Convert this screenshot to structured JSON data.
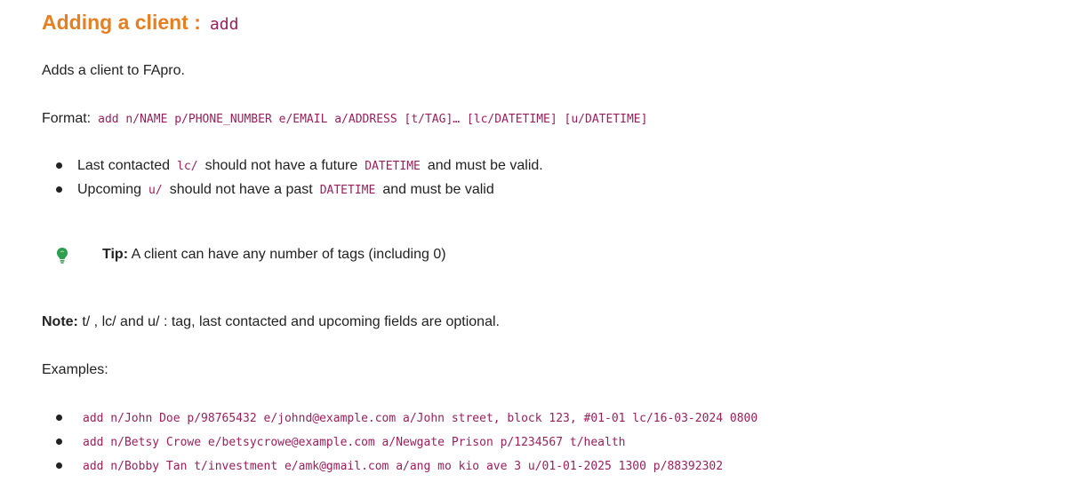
{
  "heading": {
    "title": "Adding a client :",
    "command": "add"
  },
  "description": "Adds a client to FApro.",
  "format": {
    "label": "Format:",
    "syntax": "add n/NAME p/PHONE_NUMBER e/EMAIL a/ADDRESS [t/TAG]… [lc/DATETIME] [u/DATETIME]"
  },
  "rules": [
    {
      "pre": "Last contacted",
      "code1": "lc/",
      "mid": "should not have a future",
      "code2": "DATETIME",
      "post": "and must be valid."
    },
    {
      "pre": "Upcoming",
      "code1": "u/",
      "mid": "should not have a past",
      "code2": "DATETIME",
      "post": "and must be valid"
    }
  ],
  "tip": {
    "icon": "lightbulb-icon",
    "label": "Tip:",
    "text": "A client can have any number of tags (including 0)"
  },
  "note": {
    "label": "Note:",
    "text": "t/ , lc/ and u/ : tag, last contacted and upcoming fields are optional."
  },
  "examples_label": "Examples:",
  "examples": [
    "add n/John Doe p/98765432 e/johnd@example.com a/John street, block 123, #01-01 lc/16-03-2024 0800",
    "add n/Betsy Crowe e/betsycrowe@example.com a/Newgate Prison p/1234567 t/health",
    "add n/Bobby Tan t/investment e/amk@gmail.com a/ang mo kio ave 3 u/01-01-2025 1300 p/88392302"
  ],
  "colors": {
    "heading": "#e67e22",
    "code": "#9a1f5b",
    "bulb": "#2e9e4f"
  }
}
